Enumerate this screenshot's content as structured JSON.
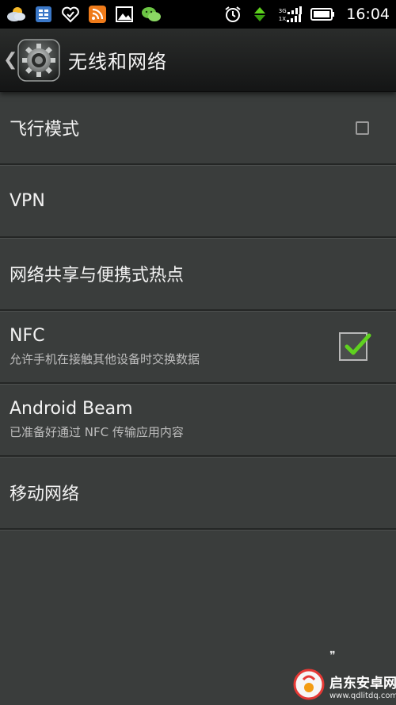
{
  "status_bar": {
    "time": "16:04",
    "net_3g": "3G",
    "net_1x": "1X",
    "left_icons": [
      "weather-icon",
      "app-grid-icon",
      "heart-shield-icon",
      "rss-icon",
      "gallery-icon",
      "wechat-icon"
    ],
    "right_icons": [
      "alarm-icon",
      "data-transfer-icon",
      "signal-icon",
      "battery-icon"
    ]
  },
  "action_bar": {
    "title": "无线和网络",
    "back_glyph": "❮"
  },
  "settings": {
    "items": [
      {
        "title": "飞行模式",
        "summary": "",
        "checkbox": "unchecked"
      },
      {
        "title": "VPN",
        "summary": ""
      },
      {
        "title": "网络共享与便携式热点",
        "summary": ""
      },
      {
        "title": "NFC",
        "summary": "允许手机在接触其他设备时交换数据",
        "checkbox": "checked"
      },
      {
        "title": "Android Beam",
        "summary": "已准备好通过 NFC 传输应用内容"
      },
      {
        "title": "移动网络",
        "summary": ""
      }
    ]
  },
  "watermark": {
    "name": "启东安卓网",
    "url": "www.qdlitdq.com"
  },
  "colors": {
    "background": "#3a3d3c",
    "check_accent": "#5fd11f",
    "status_bar": "#000000"
  }
}
